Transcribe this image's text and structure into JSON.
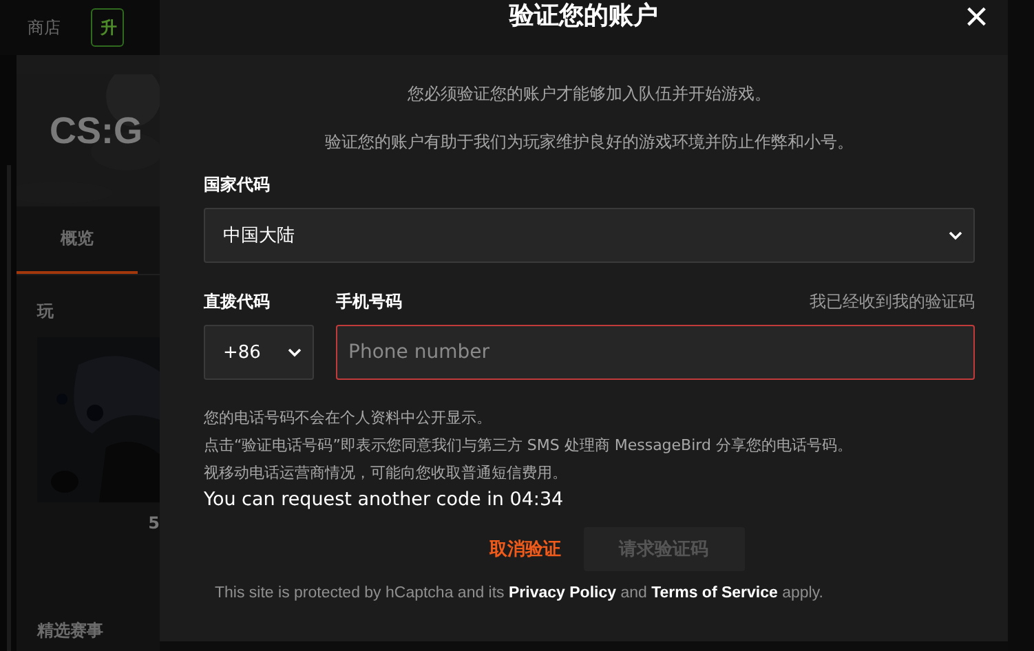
{
  "background_page": {
    "nav": [
      {
        "label": "商店",
        "kind": "link"
      },
      {
        "label": "升",
        "kind": "button"
      }
    ],
    "game_title": "CS:G",
    "tabs": [
      {
        "label": "概览",
        "selected": true
      }
    ],
    "section_title": "玩",
    "card_caption": "5",
    "section_title_2": "精选赛事"
  },
  "modal": {
    "title": "验证您的账户",
    "close": "×",
    "intro": [
      "您必须验证您的账户才能够加入队伍并开始游戏。",
      "验证您的账户有助于我们为玩家维护良好的游戏环境并防止作弊和小号。"
    ],
    "country": {
      "label": "国家代码",
      "value": "中国大陆"
    },
    "dial": {
      "label": "直拨代码",
      "value": "+86"
    },
    "phone": {
      "label": "手机号码",
      "placeholder": "Phone number",
      "error": true
    },
    "have_code_link": "我已经收到我的验证码",
    "notes": [
      "您的电话号码不会在个人资料中公开显示。",
      "点击“验证电话号码”即表示您同意我们与第三方 SMS 处理商 MessageBird 分享您的电话号码。",
      "视移动电话运营商情况，可能向您收取普通短信费用。"
    ],
    "countdown": "You can request another code in 04:34",
    "cancel": "取消验证",
    "request": {
      "label": "请求验证码",
      "disabled": true
    },
    "footer": [
      "This site is protected by hCaptcha and its ",
      "**Privacy Policy**",
      " and ",
      "**Terms of Service**",
      " apply."
    ]
  }
}
